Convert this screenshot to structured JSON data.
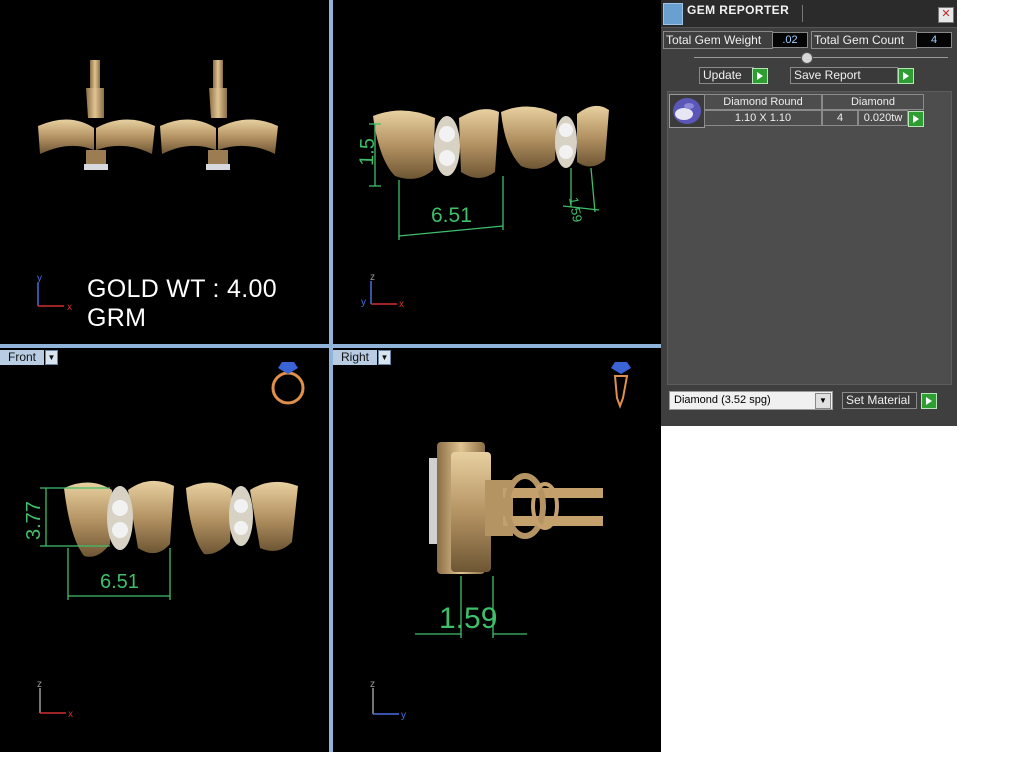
{
  "viewports": {
    "top_left": {
      "axis_v": "y",
      "axis_h": "x"
    },
    "top_right": {
      "axis_v": "z",
      "axis_v2": "y",
      "axis_h": "x",
      "dim_height": "1.5",
      "dim_width": "6.51",
      "dim_depth": "1.59"
    },
    "bottom_left": {
      "tab": "Front",
      "axis_v": "z",
      "axis_h": "x",
      "dim_height": "3.77",
      "dim_width": "6.51"
    },
    "bottom_right": {
      "tab": "Right",
      "axis_v": "z",
      "axis_h": "y",
      "dim_depth": "1.59"
    }
  },
  "overlay": {
    "gold_weight": "GOLD WT : 4.00 GRM"
  },
  "gem_reporter": {
    "title": "GEM REPORTER",
    "total_gem_weight_label": "Total Gem Weight",
    "total_gem_weight_value": ".02",
    "total_gem_count_label": "Total Gem Count",
    "total_gem_count_value": "4",
    "update_label": "Update",
    "save_report_label": "Save Report",
    "gem": {
      "shape": "Diamond Round",
      "type": "Diamond",
      "size": "1.10 X 1.10",
      "count": "4",
      "weight": "0.020tw"
    },
    "material_selected": "Diamond    (3.52 spg)",
    "set_material_label": "Set Material"
  },
  "colors": {
    "gold": "#c9a873",
    "dimension": "#3fbf6a",
    "viewport_border": "#8fb3d9",
    "axis_red": "#d23030",
    "axis_blue": "#4a6ee0"
  }
}
